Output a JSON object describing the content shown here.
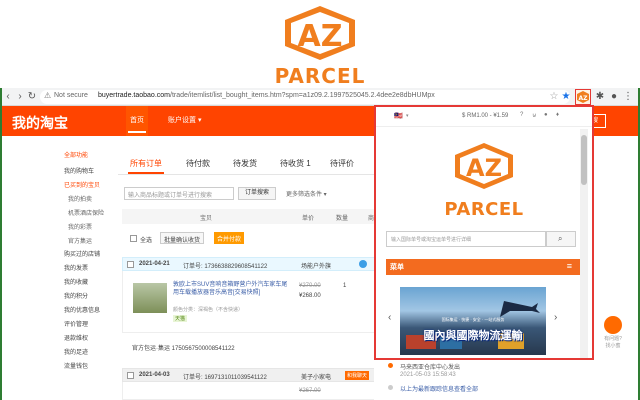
{
  "banner": {
    "logo_word": "PARCEL"
  },
  "browser": {
    "not_secure": "Not secure",
    "url_host": "buyertrade.taobao.com",
    "url_path": "/trade/itemlist/list_bought_items.htm?spm=a1z09.2.1997525045.2.4dee2e8dbHUMpx"
  },
  "taobao": {
    "title": "我的淘宝",
    "nav_home": "首页",
    "nav_account": "账户设置 ▾",
    "search_btn": "搜"
  },
  "sidebar": {
    "items": [
      {
        "label": "全部功能",
        "style": "red"
      },
      {
        "label": "我的购物车",
        "style": ""
      },
      {
        "label": "已买到的宝贝",
        "style": "red"
      },
      {
        "label": "我的拍卖",
        "style": "sub"
      },
      {
        "label": "机票酒店保险",
        "style": "sub"
      },
      {
        "label": "我的彩票",
        "style": "sub"
      },
      {
        "label": "官方集运",
        "style": "sub"
      },
      {
        "label": "购买过的店铺",
        "style": ""
      },
      {
        "label": "我的发票",
        "style": ""
      },
      {
        "label": "我的收藏",
        "style": ""
      },
      {
        "label": "我的积分",
        "style": ""
      },
      {
        "label": "我的优惠信息",
        "style": ""
      },
      {
        "label": "评价管理",
        "style": ""
      },
      {
        "label": "退款维权",
        "style": ""
      },
      {
        "label": "我的足迹",
        "style": ""
      },
      {
        "label": "流量钱包",
        "style": ""
      }
    ]
  },
  "main": {
    "tabs": [
      "所有订单",
      "待付款",
      "待发货",
      "待收货 1",
      "待评价"
    ],
    "search_placeholder": "输入商品标题或订单号进行搜索",
    "search_button": "订单搜索",
    "more_filter": "更多筛选条件 ▾",
    "columns": [
      "宝贝",
      "单价",
      "数量",
      "商"
    ],
    "select_all": "全选",
    "batch_confirm": "批量确认收货",
    "merge_pay": "合并付款",
    "order1": {
      "date": "2021-04-21",
      "order_no": "订单号: 1736638829608541122",
      "shop": "场能户外旗",
      "title": "敦欧上市SUV音响音箱野营户外汽车家车尾用车载播放器音乐高音[交易快照]",
      "attr": "颜色分类：深褐色（不含快递）",
      "price_old": "¥270.00",
      "price_new": "¥268.00",
      "qty": "1",
      "tag": "天猫"
    },
    "shop_line": "官方包运·集运 1750567500008541122",
    "order2": {
      "date": "2021-04-03",
      "order_no": "订单号: 1697131011039541122",
      "shop": "美子小家电",
      "price_old": "¥267.00",
      "tag": "和我聊天"
    }
  },
  "popup": {
    "flag": "🇲🇾",
    "currency": "$ RM1.00 - ¥1.59",
    "logo_word": "PARCEL",
    "search_placeholder": "输入国际单号或淘宝运单号进行详细",
    "menu_label": "菜单",
    "banner_small": "国际集运 · 快捷 · 安全 · 一站式服务",
    "banner_text": "國內與國際物流運輸",
    "track1": "马来西亚仓库中心发出",
    "track2": "2021-05-03 15:58:43",
    "track3": "以上为最新跟踪信息查看全部"
  },
  "help": {
    "line1": "有问题?",
    "line2": "找小蜜"
  }
}
